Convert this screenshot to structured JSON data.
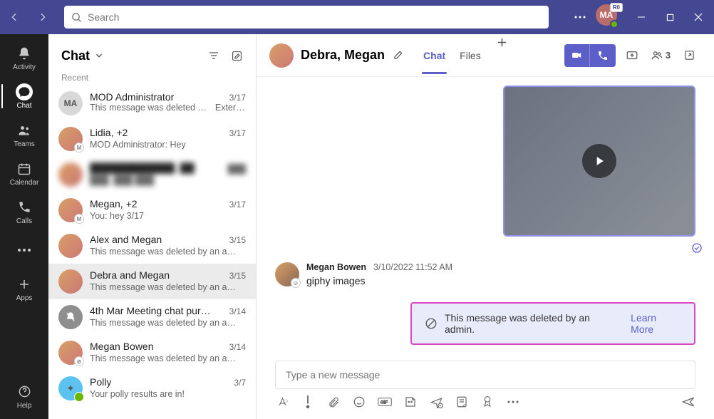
{
  "search": {
    "placeholder": "Search"
  },
  "profile": {
    "initials": "MA",
    "org": "R0"
  },
  "rail": {
    "activity": "Activity",
    "chat": "Chat",
    "teams": "Teams",
    "calendar": "Calendar",
    "calls": "Calls",
    "apps": "Apps",
    "help": "Help"
  },
  "chatList": {
    "title": "Chat",
    "sectionLabel": "Recent",
    "items": [
      {
        "name": "MOD Administrator",
        "date": "3/17",
        "preview": "This message was deleted by …",
        "tag": "External",
        "initials": "MA"
      },
      {
        "name": "Lidia, +2",
        "date": "3/17",
        "preview": "MOD Administrator: Hey"
      },
      {
        "name": "████████████, ██",
        "date": "███",
        "preview": "███, ███ ███"
      },
      {
        "name": "Megan, +2",
        "date": "3/17",
        "preview": "You: hey 3/17"
      },
      {
        "name": "Alex and Megan",
        "date": "3/15",
        "preview": "This message was deleted by an a…"
      },
      {
        "name": "Debra and Megan",
        "date": "3/15",
        "preview": "This message was deleted by an a…"
      },
      {
        "name": "4th Mar Meeting chat pur…",
        "date": "3/14",
        "preview": "This message was deleted by an a…"
      },
      {
        "name": "Megan Bowen",
        "date": "3/14",
        "preview": "This message was deleted by an a…"
      },
      {
        "name": "Polly",
        "date": "3/7",
        "preview": "Your polly results are in!"
      }
    ]
  },
  "chatHeader": {
    "title": "Debra, Megan",
    "tabs": {
      "chat": "Chat",
      "files": "Files"
    },
    "peopleCount": "3"
  },
  "message": {
    "author": "Megan Bowen",
    "timestamp": "3/10/2022 11:52 AM",
    "text": "giphy images"
  },
  "deletedBanner": {
    "text": "This message was deleted by an admin.",
    "link": "Learn More"
  },
  "compose": {
    "placeholder": "Type a new message"
  }
}
